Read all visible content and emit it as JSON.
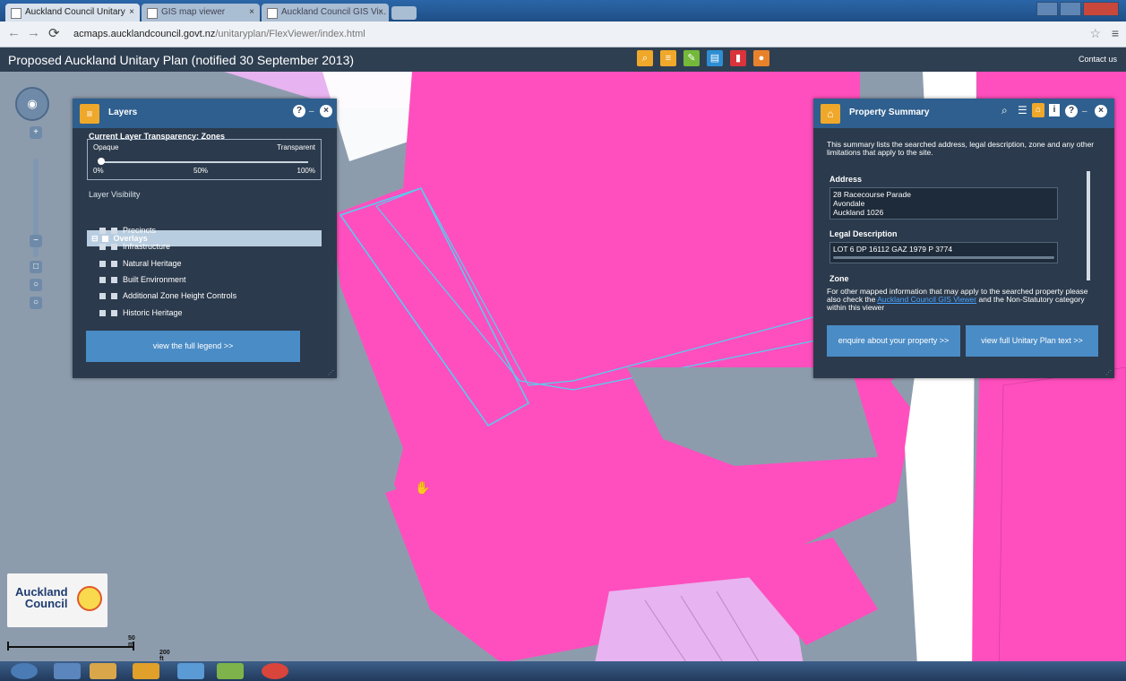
{
  "browser": {
    "tabs": [
      {
        "label": "Auckland Council Unitary"
      },
      {
        "label": "GIS map viewer"
      },
      {
        "label": "Auckland Council GIS Vi..."
      }
    ],
    "url_host": "acmaps.aucklandcouncil.govt.nz",
    "url_path": "/unitaryplan/FlexViewer/index.html"
  },
  "app": {
    "title": "Proposed Auckland Unitary Plan (notified 30 September 2013)",
    "contact_label": "Contact us",
    "toolbar_icons": [
      {
        "name": "search-icon",
        "color": "#f0a82a"
      },
      {
        "name": "layers-icon",
        "color": "#f0a82a"
      },
      {
        "name": "draw-icon",
        "color": "#74b93a"
      },
      {
        "name": "print-icon",
        "color": "#2d8ed3"
      },
      {
        "name": "bookmark-icon",
        "color": "#d9333b"
      },
      {
        "name": "location-icon",
        "color": "#e8822a"
      }
    ]
  },
  "layers_panel": {
    "title": "Layers",
    "transparency_heading": "Current Layer Transparency: Zones",
    "opaque_label": "Opaque",
    "transparent_label": "Transparent",
    "ticks": [
      "0%",
      "50%",
      "100%"
    ],
    "transparency_value_percent": 0,
    "visibility_label": "Layer Visibility",
    "overlays_label": "Overlays",
    "items": [
      {
        "label": "Precincts"
      },
      {
        "label": "Infrastructure"
      },
      {
        "label": "Natural Heritage"
      },
      {
        "label": "Built Environment"
      },
      {
        "label": "Additional Zone Height Controls"
      },
      {
        "label": "Historic Heritage"
      }
    ],
    "legend_button": "view the full legend >>"
  },
  "summary_panel": {
    "title": "Property Summary",
    "intro": "This summary lists the searched address, legal description, zone and any other limitations that apply to the site.",
    "address_heading": "Address",
    "address_lines": [
      "28 Racecourse Parade",
      "Avondale",
      "Auckland    1026"
    ],
    "legal_heading": "Legal Description",
    "legal_value": "LOT 6 DP 16112 GAZ 1979 P 3774",
    "zone_heading": "Zone",
    "other_info_before": "For other mapped information that may apply to the searched property please also check the",
    "other_info_link": "Auckland Council GIS Viewer",
    "other_info_after": "and the Non-Statutory category within this viewer",
    "enquire_button": "enquire about your property >>",
    "fulltext_button": "view full Unitary Plan text >>"
  },
  "logo": {
    "line1": "Auckland",
    "line2": "Council"
  },
  "scale": {
    "top_label": "50 m",
    "bottom_label": "200 ft"
  },
  "colors": {
    "zone_pink": "#ff4fbe",
    "zone_lilac": "#e7b3f0",
    "road_grey": "#8d9cad",
    "panel_bg": "#2b3a4c",
    "panel_header": "#2e5f8e",
    "button_blue": "#4a8cc6"
  }
}
